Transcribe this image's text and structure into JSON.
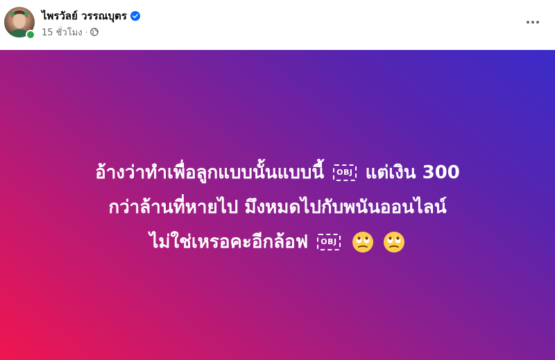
{
  "post": {
    "author": {
      "name": "ไพรวัลย์ วรรณบุตร",
      "verified": true,
      "online": true
    },
    "meta": {
      "time": "15 ชั่วโมง",
      "separator": "·",
      "privacy_icon": "globe-icon"
    },
    "more_icon": "more-options-icon",
    "background": {
      "colors": [
        "#f0154f",
        "#c4196e",
        "#8a1f90",
        "#5a24ad",
        "#3a2bc9"
      ]
    },
    "text": {
      "line1_part1": "อ้างว่าทำเพื่อลูกแบบนั้นแบบนี้",
      "line1_obj": "OBJ",
      "line1_part2": "แต่เงิน 300",
      "line2": "กว่าล้านที่หายไป มึงหมดไปกับพนันออนไลน์",
      "line3_part1": "ไม่ใช่เหรอคะอีกล้อฟ",
      "line3_obj": "OBJ",
      "emoji": "face-with-rolling-eyes"
    }
  }
}
